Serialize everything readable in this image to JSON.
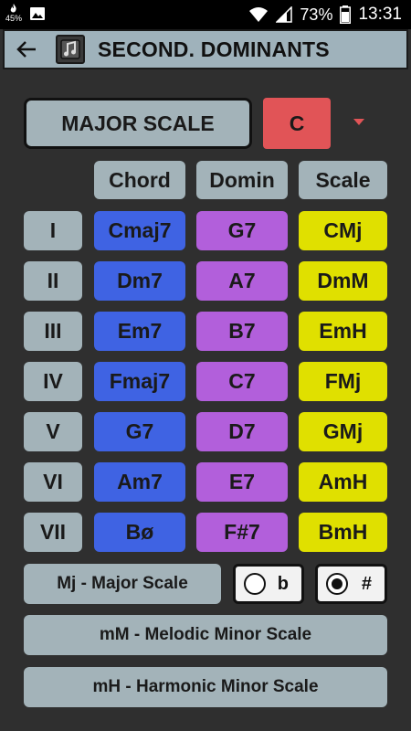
{
  "status_bar": {
    "battery_small": "45%",
    "battery_percent": "73%",
    "time": "13:31"
  },
  "toolbar": {
    "title": "SECOND. DOMINANTS"
  },
  "controls": {
    "scale_button": "MAJOR SCALE",
    "key_button": "C"
  },
  "headers": {
    "chord": "Chord",
    "dominant": "Domin",
    "scale": "Scale"
  },
  "rows": [
    {
      "degree": "I",
      "chord": "Cmaj7",
      "dominant": "G7",
      "scale": "CMj"
    },
    {
      "degree": "II",
      "chord": "Dm7",
      "dominant": "A7",
      "scale": "DmM"
    },
    {
      "degree": "III",
      "chord": "Em7",
      "dominant": "B7",
      "scale": "EmH"
    },
    {
      "degree": "IV",
      "chord": "Fmaj7",
      "dominant": "C7",
      "scale": "FMj"
    },
    {
      "degree": "V",
      "chord": "G7",
      "dominant": "D7",
      "scale": "GMj"
    },
    {
      "degree": "VI",
      "chord": "Am7",
      "dominant": "E7",
      "scale": "AmH"
    },
    {
      "degree": "VII",
      "chord": "Bø",
      "dominant": "F#7",
      "scale": "BmH"
    }
  ],
  "legend": {
    "major": "Mj - Major Scale",
    "melodic": "mM - Melodic Minor Scale",
    "harmonic": "mH - Harmonic Minor Scale"
  },
  "accidentals": {
    "flat": {
      "label": "b",
      "selected": false
    },
    "sharp": {
      "label": "#",
      "selected": true
    }
  },
  "colors": {
    "chord": "#3f63e3",
    "dominant": "#b25fdb",
    "scale": "#e0e000",
    "key": "#e15457",
    "neutral": "#a3b3b9"
  }
}
